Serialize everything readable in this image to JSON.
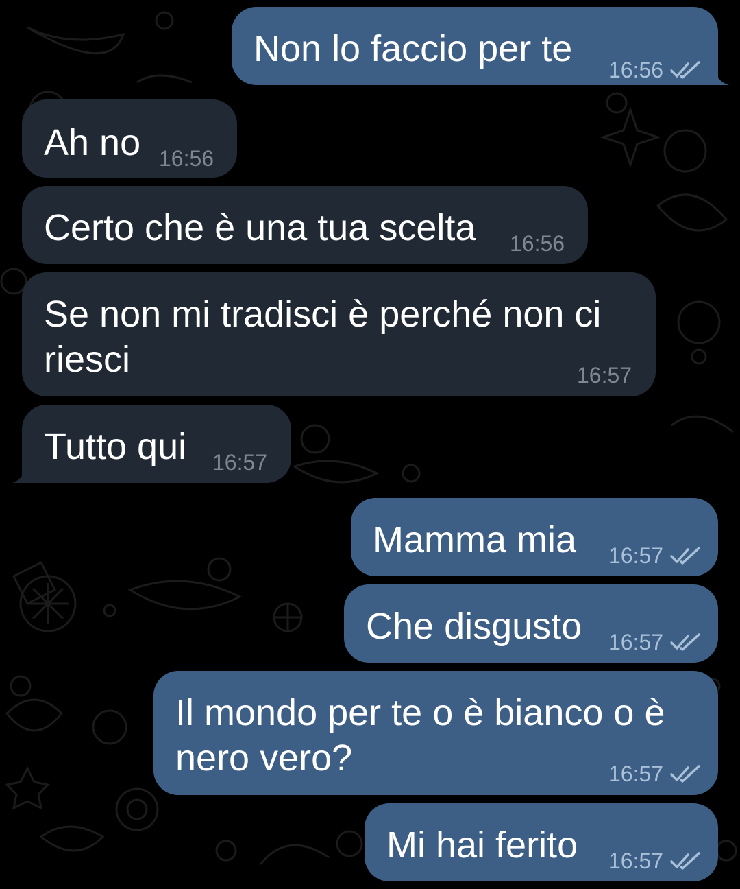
{
  "theme": {
    "background": "#000000",
    "incoming_bubble": "#212a34",
    "outgoing_bubble": "#3d5f86",
    "text": "#ffffff",
    "incoming_time": "#7d8893",
    "outgoing_time": "#a9c0d9"
  },
  "messages": [
    {
      "direction": "outgoing",
      "text": "Non lo faccio per te",
      "time": "16:56",
      "status": "read-double-check-icon"
    },
    {
      "direction": "incoming",
      "text": "Ah no",
      "time": "16:56"
    },
    {
      "direction": "incoming",
      "text": "Certo che è una tua scelta",
      "time": "16:56"
    },
    {
      "direction": "incoming",
      "text_line1": "Se non mi tradisci è perché non ci",
      "text_line2": "riesci",
      "time": "16:57"
    },
    {
      "direction": "incoming",
      "text": "Tutto qui",
      "time": "16:57"
    },
    {
      "direction": "outgoing",
      "text": "Mamma mia",
      "time": "16:57",
      "status": "read-double-check-icon"
    },
    {
      "direction": "outgoing",
      "text": "Che disgusto",
      "time": "16:57",
      "status": "read-double-check-icon"
    },
    {
      "direction": "outgoing",
      "text_line1": "Il mondo per te o è bianco o è",
      "text_line2": "nero vero?",
      "time": "16:57",
      "status": "read-double-check-icon"
    },
    {
      "direction": "outgoing",
      "text": "Mi hai ferito",
      "time": "16:57",
      "status": "read-double-check-icon"
    }
  ]
}
